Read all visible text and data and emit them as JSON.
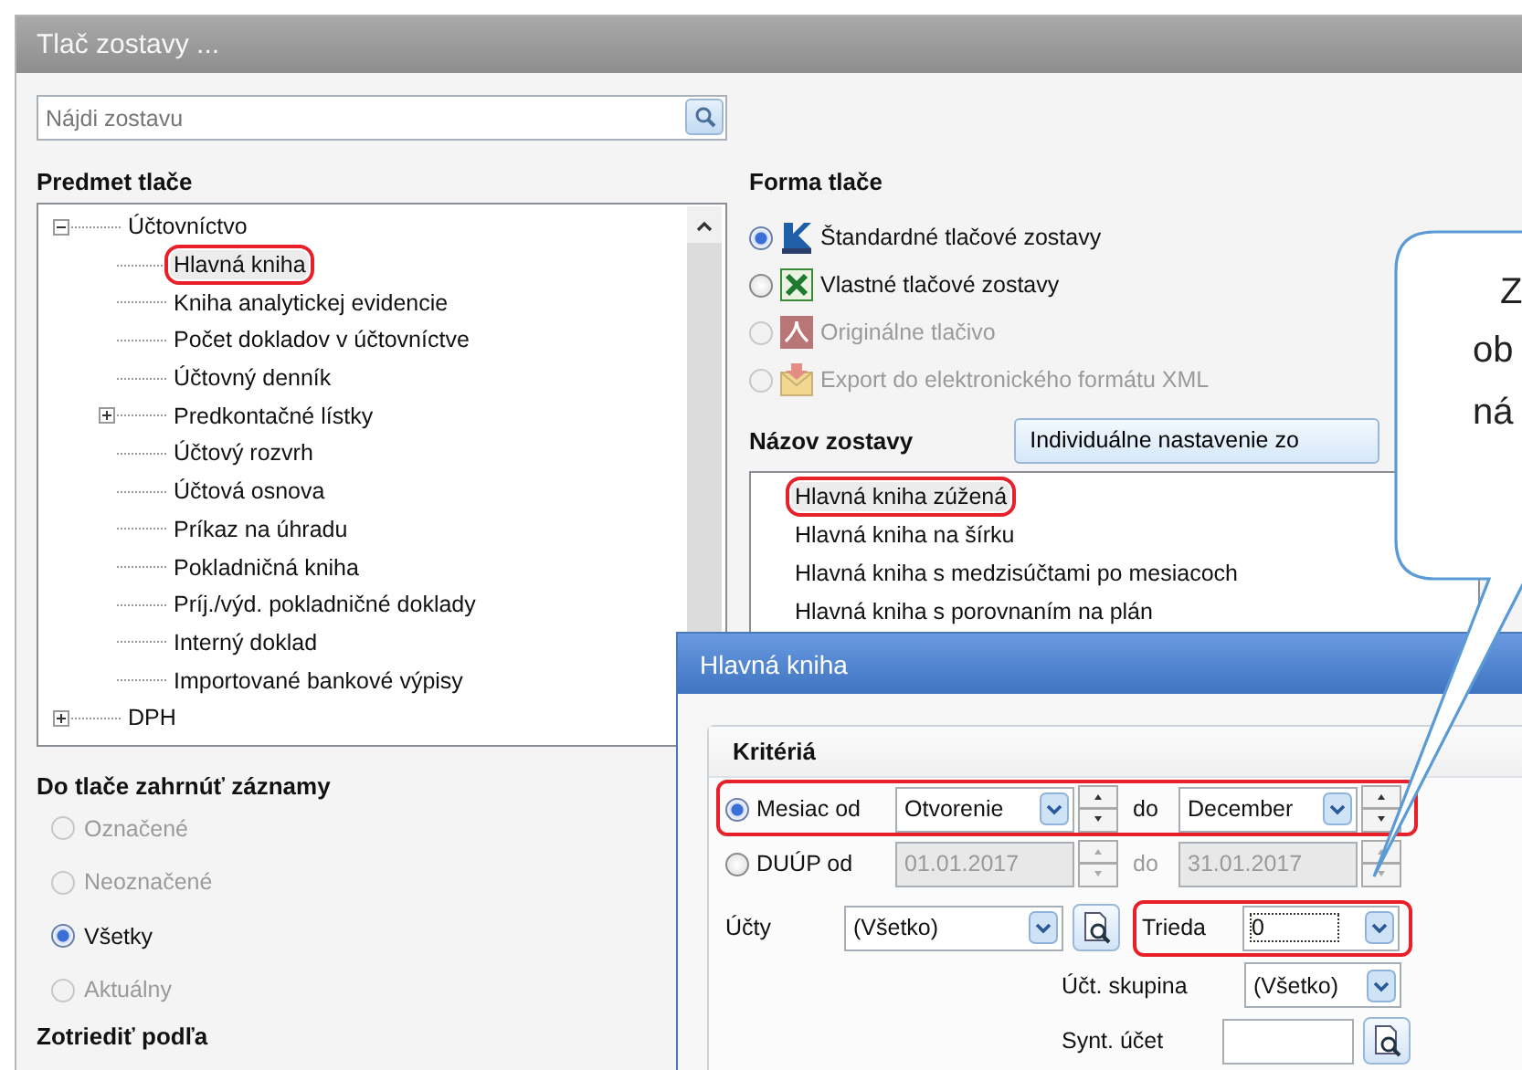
{
  "window": {
    "title": "Tlač zostavy ..."
  },
  "search": {
    "placeholder": "Nájdi zostavu"
  },
  "subject": {
    "heading": "Predmet tlače",
    "tree": [
      {
        "label": "Účtovníctvo",
        "kind": "folder",
        "expanded": true,
        "selected": false,
        "circled": false,
        "children": [
          {
            "label": "Hlavná kniha",
            "kind": "leaf",
            "selected": true,
            "circled": true
          },
          {
            "label": "Kniha analytickej evidencie",
            "kind": "leaf",
            "selected": false,
            "circled": false
          },
          {
            "label": "Počet dokladov v účtovníctve",
            "kind": "leaf",
            "selected": false,
            "circled": false
          },
          {
            "label": "Účtovný denník",
            "kind": "leaf",
            "selected": false,
            "circled": false
          },
          {
            "label": "Predkontačné lístky",
            "kind": "folder",
            "expanded": false,
            "selected": false,
            "circled": false
          },
          {
            "label": "Účtový rozvrh",
            "kind": "leaf",
            "selected": false,
            "circled": false
          },
          {
            "label": "Účtová osnova",
            "kind": "leaf",
            "selected": false,
            "circled": false
          },
          {
            "label": "Príkaz na úhradu",
            "kind": "leaf",
            "selected": false,
            "circled": false
          },
          {
            "label": "Pokladničná kniha",
            "kind": "leaf",
            "selected": false,
            "circled": false
          },
          {
            "label": "Príj./výd. pokladničné doklady",
            "kind": "leaf",
            "selected": false,
            "circled": false
          },
          {
            "label": "Interný doklad",
            "kind": "leaf",
            "selected": false,
            "circled": false
          },
          {
            "label": "Importované bankové výpisy",
            "kind": "leaf",
            "selected": false,
            "circled": false
          }
        ]
      },
      {
        "label": "DPH",
        "kind": "folder",
        "expanded": false,
        "selected": false,
        "circled": false
      }
    ]
  },
  "include": {
    "heading": "Do tlače zahrnúť záznamy",
    "options": [
      {
        "label": "Označené",
        "selected": false,
        "disabled": true
      },
      {
        "label": "Neoznačené",
        "selected": false,
        "disabled": true
      },
      {
        "label": "Všetky",
        "selected": true,
        "disabled": false
      },
      {
        "label": "Aktuálny",
        "selected": false,
        "disabled": true
      }
    ]
  },
  "sort": {
    "heading": "Zotriediť podľa"
  },
  "form": {
    "heading": "Forma tlače",
    "options": [
      {
        "label": "Štandardné tlačové zostavy",
        "kind": "standard",
        "selected": true,
        "disabled": false
      },
      {
        "label": "Vlastné tlačové zostavy",
        "kind": "custom",
        "selected": false,
        "disabled": false
      },
      {
        "label": "Originálne tlačivo",
        "kind": "original",
        "selected": false,
        "disabled": true
      },
      {
        "label": "Export do elektronického formátu XML",
        "kind": "export",
        "selected": false,
        "disabled": true
      }
    ]
  },
  "reports": {
    "heading": "Názov zostavy",
    "button": "Individuálne nastavenie zo",
    "items": [
      {
        "label": "Hlavná kniha zúžená",
        "selected": true,
        "circled": true
      },
      {
        "label": "Hlavná kniha na šírku",
        "selected": false,
        "circled": false
      },
      {
        "label": "Hlavná kniha s medzisúčtami po mesiacoch",
        "selected": false,
        "circled": false
      },
      {
        "label": "Hlavná kniha s porovnaním na plán",
        "selected": false,
        "circled": false
      }
    ]
  },
  "callout": {
    "lines": [
      "Z",
      "ob",
      "ná"
    ]
  },
  "dialog": {
    "title": "Hlavná kniha",
    "group": "Kritériá",
    "month": {
      "label": "Mesiac od",
      "selected": true,
      "circled": true,
      "from": "Otvorenie",
      "to_label": "do",
      "to": "December"
    },
    "period": {
      "label": "DUÚP od",
      "selected": false,
      "from": "01.01.2017",
      "to_label": "do",
      "to": "31.01.2017"
    },
    "accounts": {
      "label": "Účty",
      "value": "(Všetko)"
    },
    "class": {
      "label": "Trieda",
      "value": "0",
      "circled": true
    },
    "account_group": {
      "label": "Účt. skupina",
      "value": "(Všetko)"
    },
    "synthetic": {
      "label": "Synt. účet"
    }
  }
}
